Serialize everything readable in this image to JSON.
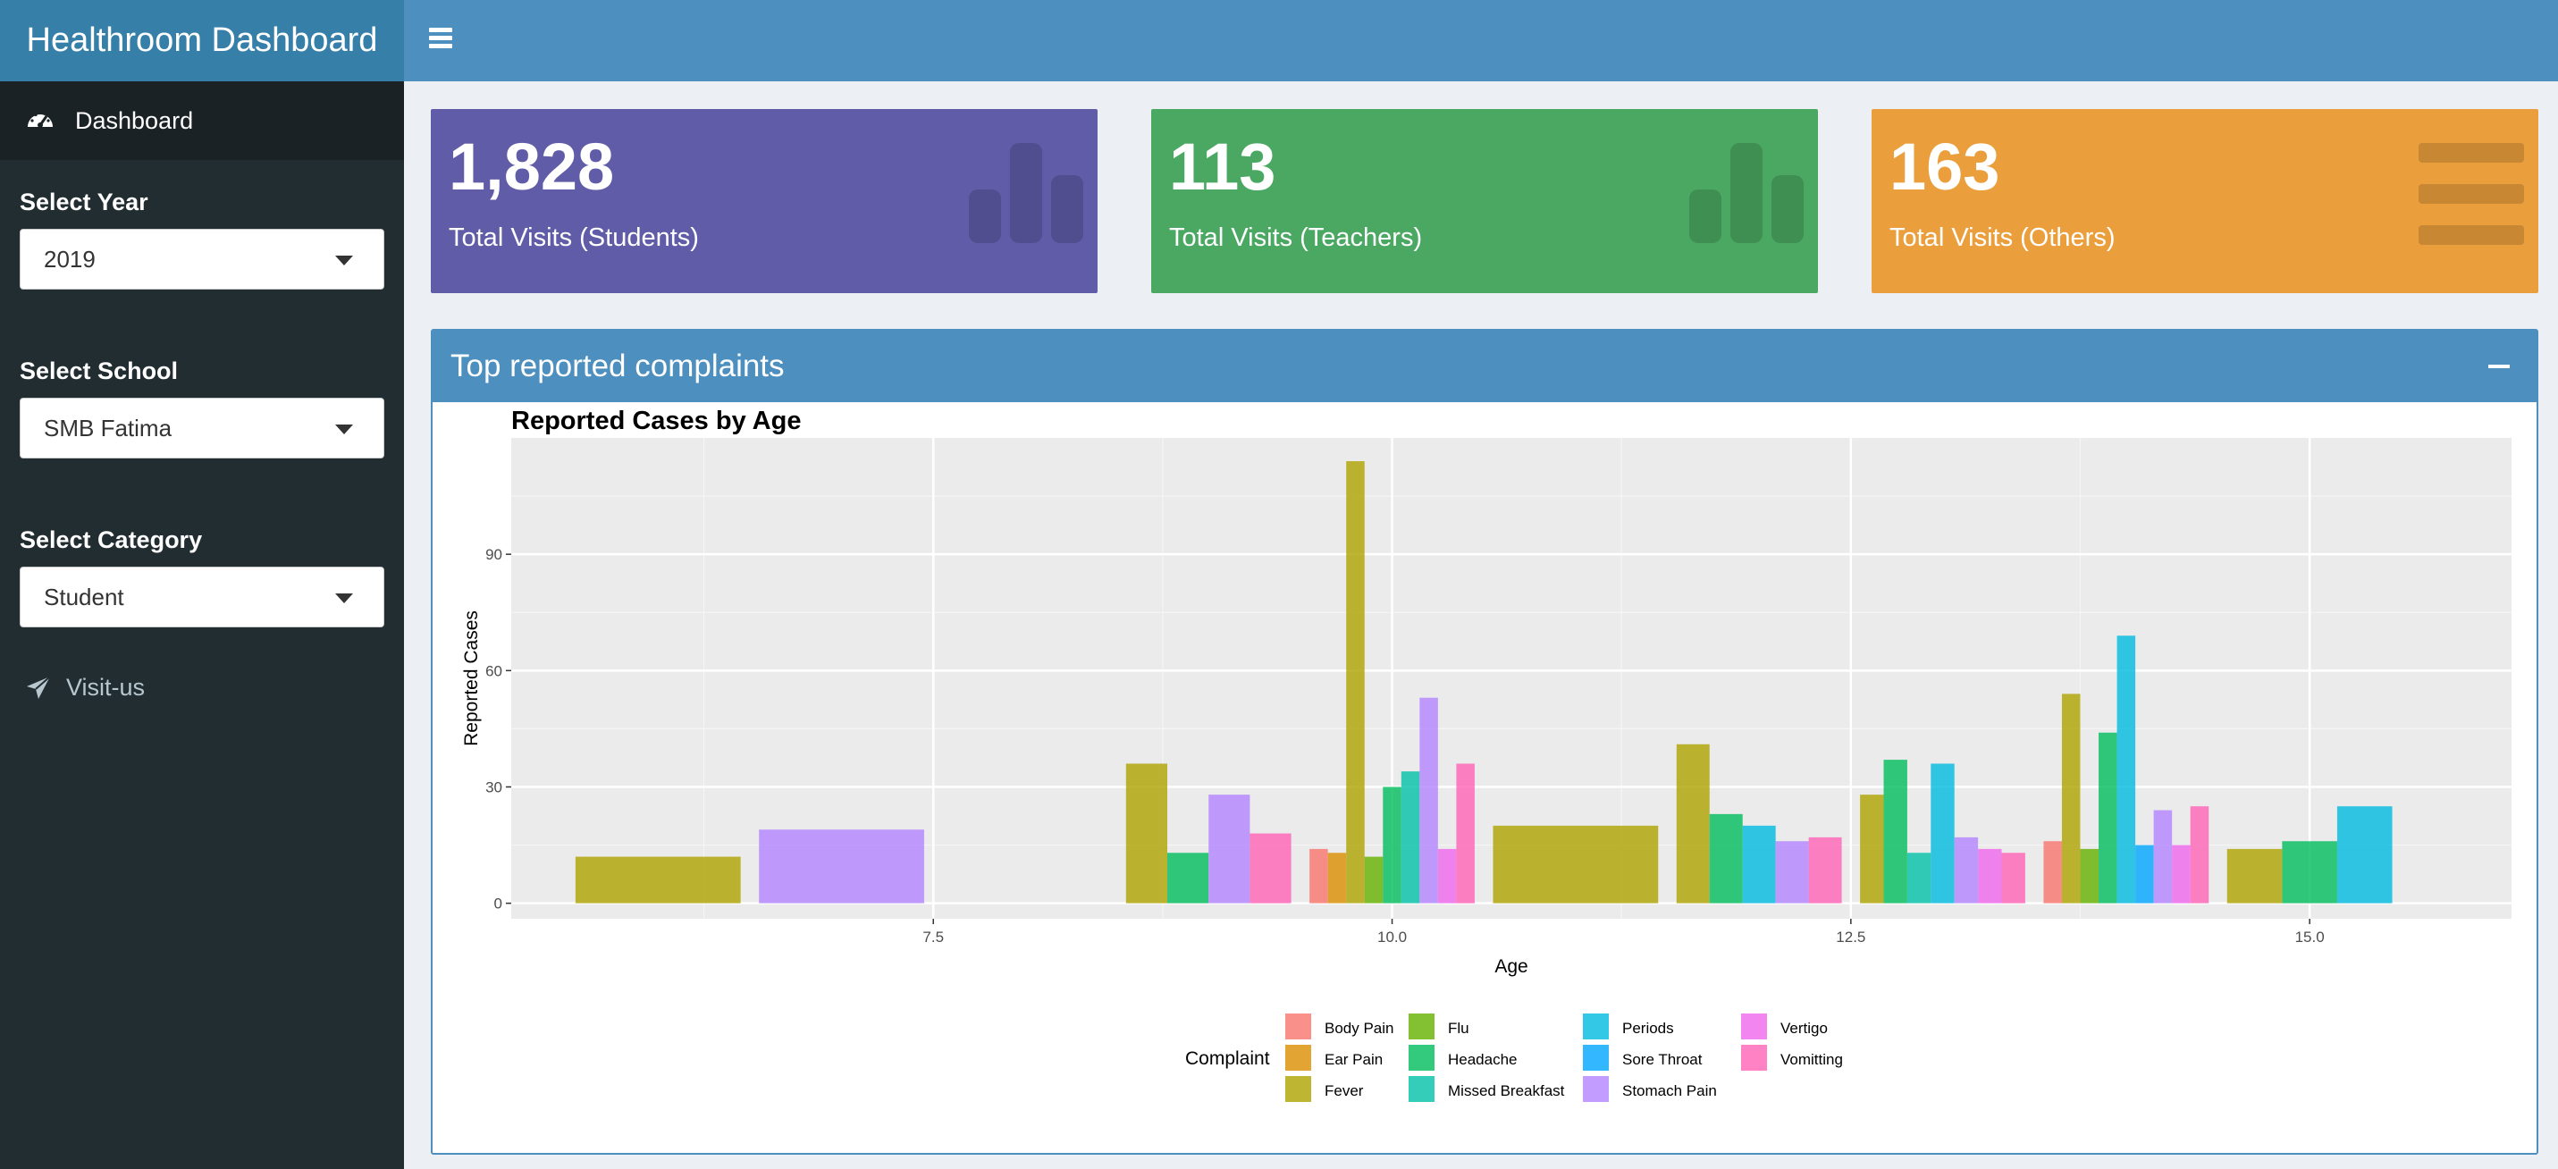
{
  "app": {
    "title": "Healthroom Dashboard"
  },
  "sidebar": {
    "dashboard_label": "Dashboard",
    "year": {
      "label": "Select Year",
      "value": "2019"
    },
    "school": {
      "label": "Select School",
      "value": "SMB Fatima"
    },
    "category": {
      "label": "Select Category",
      "value": "Student"
    },
    "visit_label": "Visit-us"
  },
  "value_boxes": [
    {
      "value": "1,828",
      "label": "Total Visits (Students)",
      "color": "#605ca8",
      "icon": "bar-chart-icon"
    },
    {
      "value": "113",
      "label": "Total Visits (Teachers)",
      "color": "#4aa862",
      "icon": "bar-chart-icon"
    },
    {
      "value": "163",
      "label": "Total Visits (Others)",
      "color": "#ea9f3c",
      "icon": "list-icon"
    }
  ],
  "panel": {
    "title": "Top reported complaints"
  },
  "chart_data": {
    "type": "bar",
    "title": "Reported Cases by Age",
    "xlabel": "Age",
    "ylabel": "Reported Cases",
    "xlim": [
      5.2,
      16.1
    ],
    "ylim": [
      -4,
      120
    ],
    "x_ticks": [
      "7.5",
      "10.0",
      "12.5",
      "15.0"
    ],
    "y_ticks": [
      "0",
      "30",
      "60",
      "90"
    ],
    "legend_title": "Complaint",
    "legend_position": "bottom",
    "complaints": [
      {
        "name": "Body Pain",
        "color": "#F8766D"
      },
      {
        "name": "Ear Pain",
        "color": "#DB8E00"
      },
      {
        "name": "Fever",
        "color": "#AEA200"
      },
      {
        "name": "Flu",
        "color": "#64B200"
      },
      {
        "name": "Headache",
        "color": "#00BD5C"
      },
      {
        "name": "Missed Breakfast",
        "color": "#00C1A7"
      },
      {
        "name": "Periods",
        "color": "#00BADE"
      },
      {
        "name": "Sore Throat",
        "color": "#00A6FF"
      },
      {
        "name": "Stomach Pain",
        "color": "#B385FF"
      },
      {
        "name": "Vertigo",
        "color": "#EF67EB"
      },
      {
        "name": "Vomitting",
        "color": "#FF63B6"
      }
    ],
    "groups": [
      {
        "age": 6,
        "bars": [
          {
            "complaint": "Fever",
            "value": 12
          }
        ]
      },
      {
        "age": 7,
        "bars": [
          {
            "complaint": "Stomach Pain",
            "value": 19
          }
        ]
      },
      {
        "age": 9,
        "bars": [
          {
            "complaint": "Fever",
            "value": 36
          },
          {
            "complaint": "Headache",
            "value": 13
          },
          {
            "complaint": "Stomach Pain",
            "value": 28
          },
          {
            "complaint": "Vomitting",
            "value": 18
          }
        ]
      },
      {
        "age": 10,
        "bars": [
          {
            "complaint": "Body Pain",
            "value": 14
          },
          {
            "complaint": "Ear Pain",
            "value": 13
          },
          {
            "complaint": "Fever",
            "value": 114
          },
          {
            "complaint": "Flu",
            "value": 12
          },
          {
            "complaint": "Headache",
            "value": 30
          },
          {
            "complaint": "Missed Breakfast",
            "value": 34
          },
          {
            "complaint": "Stomach Pain",
            "value": 53
          },
          {
            "complaint": "Vertigo",
            "value": 14
          },
          {
            "complaint": "Vomitting",
            "value": 36
          }
        ]
      },
      {
        "age": 11,
        "bars": [
          {
            "complaint": "Fever",
            "value": 20
          }
        ]
      },
      {
        "age": 12,
        "bars": [
          {
            "complaint": "Fever",
            "value": 41
          },
          {
            "complaint": "Headache",
            "value": 23
          },
          {
            "complaint": "Periods",
            "value": 20
          },
          {
            "complaint": "Stomach Pain",
            "value": 16
          },
          {
            "complaint": "Vomitting",
            "value": 17
          }
        ]
      },
      {
        "age": 13,
        "bars": [
          {
            "complaint": "Fever",
            "value": 28
          },
          {
            "complaint": "Headache",
            "value": 37
          },
          {
            "complaint": "Missed Breakfast",
            "value": 13
          },
          {
            "complaint": "Periods",
            "value": 36
          },
          {
            "complaint": "Stomach Pain",
            "value": 17
          },
          {
            "complaint": "Vertigo",
            "value": 14
          },
          {
            "complaint": "Vomitting",
            "value": 13
          }
        ]
      },
      {
        "age": 14,
        "bars": [
          {
            "complaint": "Body Pain",
            "value": 16
          },
          {
            "complaint": "Fever",
            "value": 54
          },
          {
            "complaint": "Flu",
            "value": 14
          },
          {
            "complaint": "Headache",
            "value": 44
          },
          {
            "complaint": "Periods",
            "value": 69
          },
          {
            "complaint": "Sore Throat",
            "value": 15
          },
          {
            "complaint": "Stomach Pain",
            "value": 24
          },
          {
            "complaint": "Vertigo",
            "value": 15
          },
          {
            "complaint": "Vomitting",
            "value": 25
          }
        ]
      },
      {
        "age": 15,
        "bars": [
          {
            "complaint": "Fever",
            "value": 14
          },
          {
            "complaint": "Headache",
            "value": 16
          },
          {
            "complaint": "Periods",
            "value": 25
          }
        ]
      }
    ]
  }
}
